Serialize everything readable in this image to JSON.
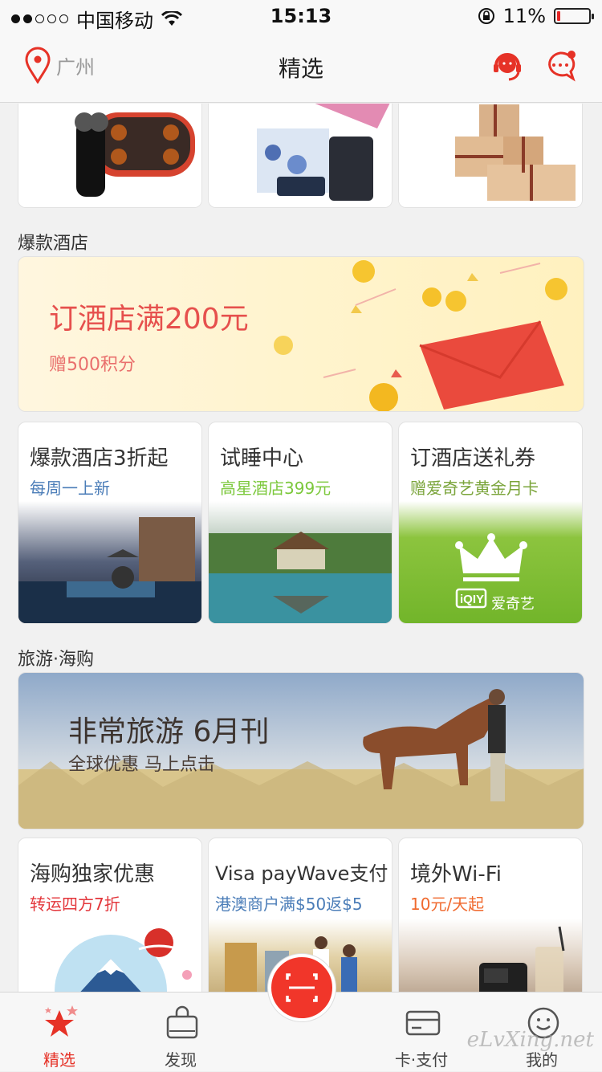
{
  "status_bar": {
    "carrier": "中国移动",
    "time": "15:13",
    "battery_text": "11%",
    "battery_level": 0.11
  },
  "nav": {
    "city": "广州",
    "title": "精选"
  },
  "sections": {
    "hotel_title": "爆款酒店",
    "travel_title": "旅游·海购"
  },
  "hotel_banner": {
    "headline": "订酒店满200元",
    "sub": "赠500积分"
  },
  "hotel_tiles": [
    {
      "title": "爆款酒店3折起",
      "sub": "每周一上新"
    },
    {
      "title": "试睡中心",
      "sub": "高星酒店399元"
    },
    {
      "title": "订酒店送礼券",
      "sub": "赠爱奇艺黄金月卡"
    }
  ],
  "iqiyi_logo_text": "爱奇艺",
  "travel_banner": {
    "headline": "非常旅游 6月刊",
    "sub": "全球优惠 马上点击"
  },
  "shop_tiles": [
    {
      "title": "海购独家优惠",
      "sub": "转运四方7折"
    },
    {
      "title": "Visa payWave支付",
      "sub": "港澳商户满$50返$5"
    },
    {
      "title": "境外Wi-Fi",
      "sub": "10元/天起"
    }
  ],
  "tabs": [
    {
      "label": "精选"
    },
    {
      "label": "发现"
    },
    {
      "label": "卡·支付"
    },
    {
      "label": "我的"
    }
  ],
  "watermark": "eLvXing.net",
  "colors": {
    "accent": "#e63227",
    "blue_sub": "#4b7db8",
    "green_sub": "#7cc83c",
    "olive_sub": "#7aa43a",
    "red_sub": "#e3363b",
    "orange_sub": "#f06a2f"
  }
}
